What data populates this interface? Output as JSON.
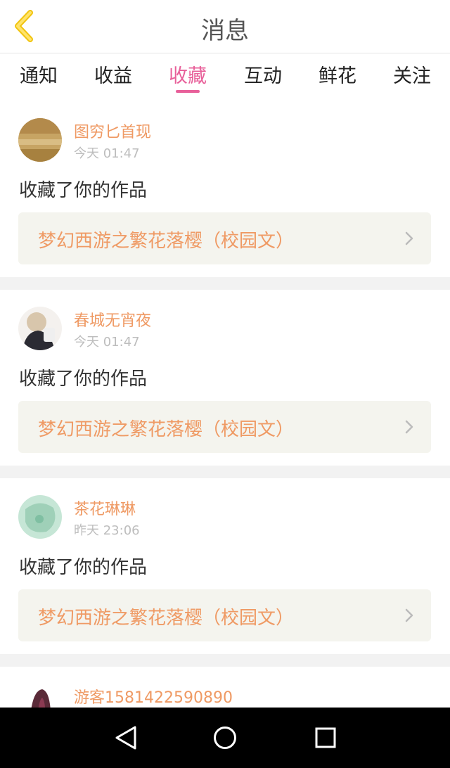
{
  "header": {
    "title": "消息",
    "back_icon": "chevron-left-icon",
    "accent": "#f1c40f"
  },
  "tabs": [
    {
      "label": "通知",
      "active": false
    },
    {
      "label": "收益",
      "active": false
    },
    {
      "label": "收藏",
      "active": true
    },
    {
      "label": "互动",
      "active": false
    },
    {
      "label": "鲜花",
      "active": false
    },
    {
      "label": "关注",
      "active": false
    }
  ],
  "feed": [
    {
      "username": "图穷匕首现",
      "time": "今天 01:47",
      "action": "收藏了你的作品",
      "work_title": "梦幻西游之繁花落樱（校园文）"
    },
    {
      "username": "春城无宵夜",
      "time": "今天 01:47",
      "action": "收藏了你的作品",
      "work_title": "梦幻西游之繁花落樱（校园文）"
    },
    {
      "username": "茶花琳琳",
      "time": "昨天 23:06",
      "action": "收藏了你的作品",
      "work_title": "梦幻西游之繁花落樱（校园文）"
    },
    {
      "username": "游客1581422590890"
    }
  ],
  "colors": {
    "active_tab": "#e8609a",
    "name": "#ef9a64",
    "work_bg": "#f4f4ee"
  },
  "system_nav": [
    "back-icon",
    "home-icon",
    "recents-icon"
  ]
}
